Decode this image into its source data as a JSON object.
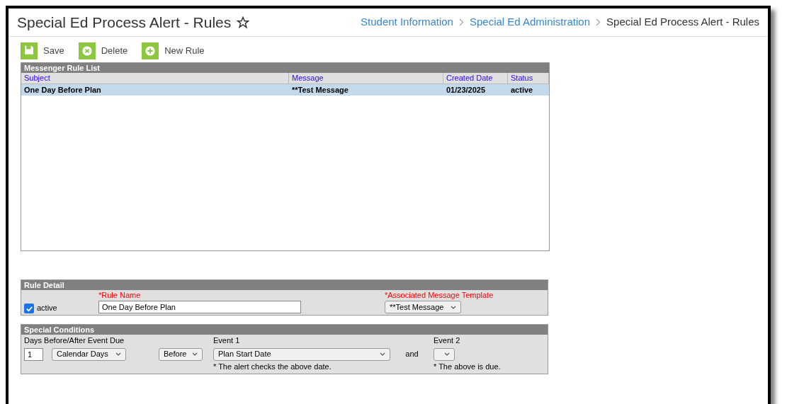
{
  "header": {
    "title": "Special Ed Process Alert - Rules",
    "favorite": false,
    "breadcrumbs": [
      {
        "label": "Student Information",
        "link": true
      },
      {
        "label": "Special Ed Administration",
        "link": true
      },
      {
        "label": "Special Ed Process Alert - Rules",
        "link": false
      }
    ]
  },
  "toolbar": [
    {
      "label": "Save",
      "kind": "save"
    },
    {
      "label": "Delete",
      "kind": "delete"
    },
    {
      "label": "New Rule",
      "kind": "add"
    }
  ],
  "rule_list": {
    "title": "Messenger Rule List",
    "columns": [
      "Subject",
      "Message",
      "Created Date",
      "Status"
    ],
    "rows": [
      {
        "cells": [
          "One Day Before Plan",
          "**Test Message",
          "01/23/2025",
          "active"
        ],
        "selected": true
      }
    ]
  },
  "rule_detail": {
    "title": "Rule Detail",
    "active": {
      "label": "active",
      "checked": true
    },
    "rule_name": {
      "label": "*Rule Name",
      "value": "One Day Before Plan"
    },
    "template": {
      "label": "*Associated Message Template",
      "value": "**Test Message"
    }
  },
  "special_conditions": {
    "title": "Special Conditions",
    "days_label": "Days Before/After Event Due",
    "days": "1",
    "day_type": "Calendar Days",
    "timing": "Before",
    "event1": {
      "label": "Event 1",
      "value": "Plan Start Date",
      "note": "* The alert checks the above date."
    },
    "and": "and",
    "event2": {
      "label": "Event 2",
      "note": "* The above is due."
    }
  }
}
